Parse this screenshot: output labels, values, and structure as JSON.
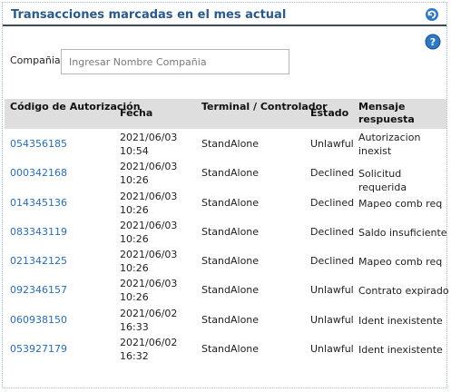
{
  "header": {
    "title": "Transacciones marcadas en el mes actual"
  },
  "filter": {
    "label": "Compañia:",
    "placeholder": "Ingresar Nombre Compañia"
  },
  "table": {
    "columns": [
      "Código de Autorización",
      "Fecha",
      "Terminal / Controlador",
      "Estado",
      "Mensaje respuesta"
    ],
    "rows": [
      {
        "code": "054356185",
        "date": "2021/06/03 10:54",
        "terminal": "StandAlone",
        "state": "Unlawful",
        "message": "Autorizacion inexist"
      },
      {
        "code": "000342168",
        "date": "2021/06/03 10:26",
        "terminal": "StandAlone",
        "state": "Declined",
        "message": "Solicitud requerida"
      },
      {
        "code": "014345136",
        "date": "2021/06/03 10:26",
        "terminal": "StandAlone",
        "state": "Declined",
        "message": "Mapeo comb req"
      },
      {
        "code": "083343119",
        "date": "2021/06/03 10:26",
        "terminal": "StandAlone",
        "state": "Declined",
        "message": "Saldo insuficiente"
      },
      {
        "code": "021342125",
        "date": "2021/06/03 10:26",
        "terminal": "StandAlone",
        "state": "Declined",
        "message": "Mapeo comb req"
      },
      {
        "code": "092346157",
        "date": "2021/06/03 10:26",
        "terminal": "StandAlone",
        "state": "Unlawful",
        "message": "Contrato expirado"
      },
      {
        "code": "060938150",
        "date": "2021/06/02 16:33",
        "terminal": "StandAlone",
        "state": "Unlawful",
        "message": "Ident inexistente"
      },
      {
        "code": "053927179",
        "date": "2021/06/02 16:32",
        "terminal": "StandAlone",
        "state": "Unlawful",
        "message": "Ident inexistente"
      }
    ]
  },
  "icons": {
    "refresh": "refresh-icon",
    "help": "help-icon"
  },
  "colors": {
    "title": "#2b5a8a",
    "link": "#2a6db0",
    "header_bg": "#dedede"
  }
}
